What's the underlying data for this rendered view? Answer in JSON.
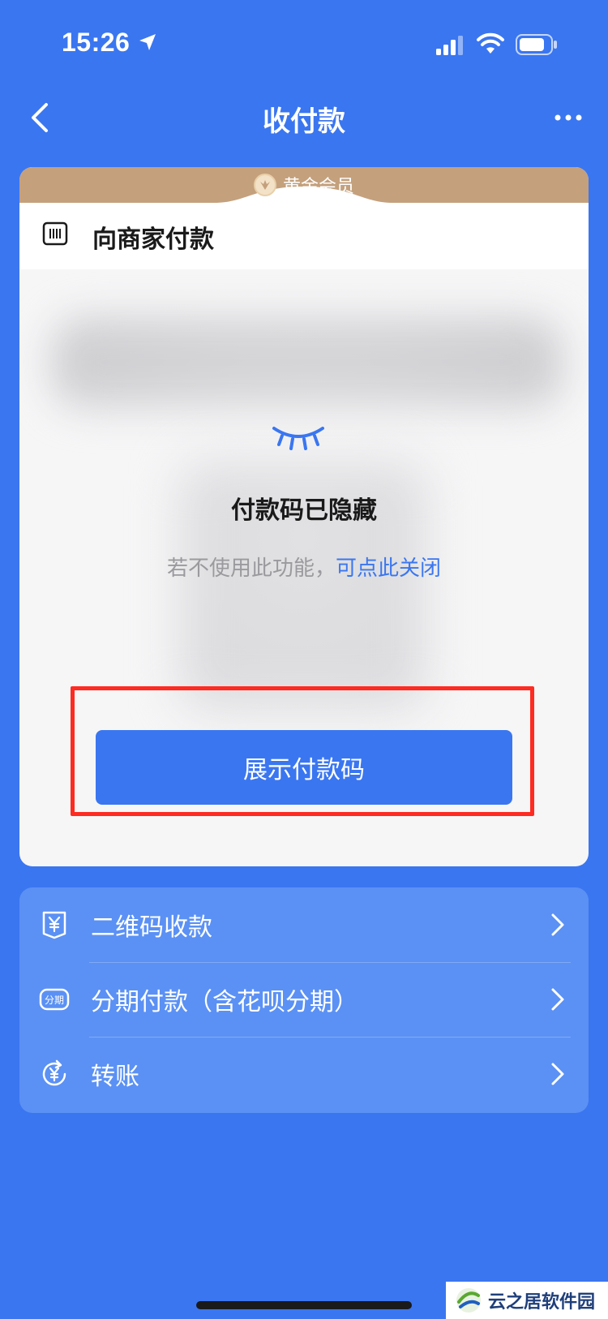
{
  "status_bar": {
    "time": "15:26",
    "icons": [
      "location-arrow-icon",
      "cellular-signal-icon",
      "wifi-icon",
      "battery-icon"
    ]
  },
  "nav": {
    "title": "收付款",
    "back_icon": "chevron-left-icon",
    "more_icon": "more-dots-icon"
  },
  "pay_card": {
    "member_label": "黄金会员",
    "merchant_title": "向商家付款",
    "hidden_title": "付款码已隐藏",
    "hint_text": "若不使用此功能，",
    "hint_link": "可点此关闭",
    "show_button": "展示付款码"
  },
  "options": [
    {
      "icon": "qr-receive-yuan-icon",
      "label": "二维码收款"
    },
    {
      "icon": "installment-icon",
      "label": "分期付款（含花呗分期）"
    },
    {
      "icon": "transfer-yuan-icon",
      "label": "转账"
    }
  ],
  "watermark": {
    "text": "云之居软件园"
  },
  "colors": {
    "background": "#3a76f0",
    "primary_button": "#3a76f0",
    "member_band": "#c4a07c",
    "highlight_border": "#ff2a20",
    "options_card": "#5b91f4",
    "link": "#3a76f0"
  }
}
